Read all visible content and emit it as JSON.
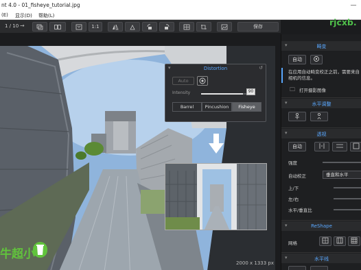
{
  "window": {
    "title": "nt 4.0 - 01_fisheye_tutorial.jpg"
  },
  "menu": {
    "items": [
      "(E)",
      "显示(D)",
      "帮助(L)"
    ]
  },
  "toolbar": {
    "pager": "1 / 10",
    "next_arrow": "→",
    "zoom_label": "1:1",
    "save_label": "保存"
  },
  "viewer": {
    "dimensions": "2000 x 1333 px"
  },
  "distortion": {
    "title": "Distortion",
    "auto_label": "Auto",
    "intensity_label": "Intensity",
    "intensity_value": "90",
    "modes": [
      "Barrel",
      "Pincushion",
      "Fisheye"
    ],
    "selected_mode": "Fisheye"
  },
  "watermarks": {
    "left_text": "牛超小",
    "right_text": "rjcxb."
  },
  "right_panel": {
    "section1": {
      "title": "畸变",
      "auto_label": "自动",
      "info_text": "在应用自动畸变校正之前，需要来自相机的信息。",
      "open_label": "打开摄影图像"
    },
    "section2": {
      "title": "水平调整"
    },
    "section3": {
      "title": "透视",
      "auto_label": "自动",
      "intensity_label": "强度",
      "auto_correct_label": "自动校正",
      "auto_correct_value": "垂直和水平",
      "vertical_label": "上/下",
      "horizontal_label": "左/右",
      "ratio_label": "水平/垂直比"
    },
    "section4": {
      "title": "ReShape",
      "grid_label": "网格"
    },
    "section5": {
      "title": "水平线"
    }
  },
  "colors": {
    "accent": "#5aa8ff",
    "watermark": "#61c33c"
  }
}
